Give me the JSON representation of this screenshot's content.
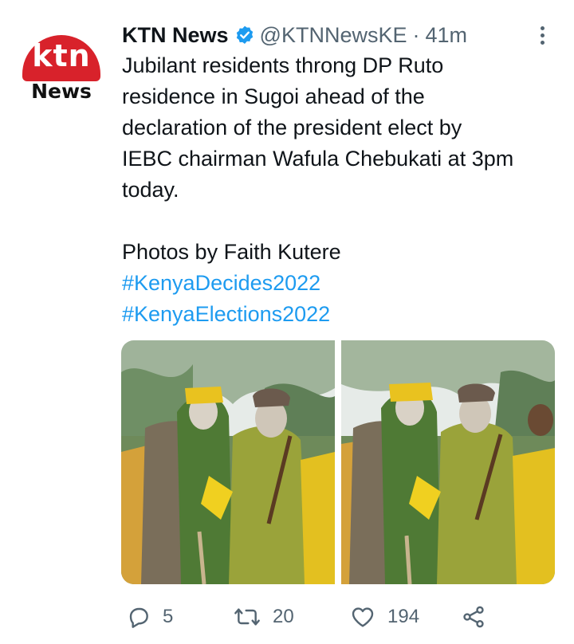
{
  "tweet": {
    "avatar": {
      "line1": "ktn",
      "line2": "News"
    },
    "author_name": "KTN News",
    "handle": "@KTNNewsKE",
    "separator": "·",
    "time": "41m",
    "text_lines": [
      "Jubilant residents throng DP Ruto",
      "residence in Sugoi ahead of the",
      "declaration of the president elect by",
      "IEBC chairman Wafula Chebukati at 3pm",
      "today."
    ],
    "credit": "Photos by Faith Kutere",
    "hashtags": [
      "#KenyaDecides2022",
      "#KenyaElections2022"
    ],
    "media": [
      {
        "alt": "photo-1"
      },
      {
        "alt": "photo-2"
      }
    ],
    "actions": {
      "reply_count": "5",
      "retweet_count": "20",
      "like_count": "194"
    }
  },
  "icons": {
    "verified": "verified-badge-icon",
    "more": "more-vertical-icon",
    "reply": "reply-icon",
    "retweet": "retweet-icon",
    "like": "heart-icon",
    "share": "share-icon"
  },
  "colors": {
    "accent": "#1d9bf0",
    "muted": "#536471",
    "text": "#0f1419",
    "brand_red": "#d8222b"
  }
}
